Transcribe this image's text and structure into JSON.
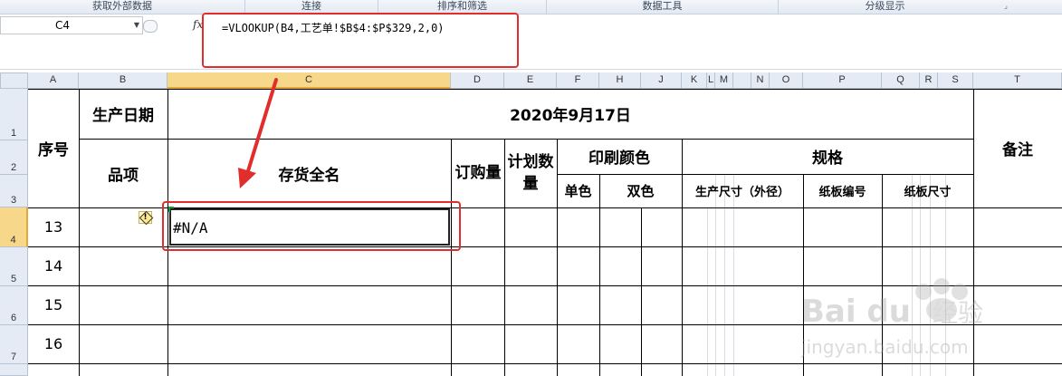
{
  "ribbon": {
    "groups": [
      "获取外部数据",
      "连接",
      "排序和筛选",
      "数据工具",
      "分级显示"
    ]
  },
  "formula_bar": {
    "name_box": "C4",
    "fx_label": "fx",
    "formula": "=VLOOKUP(B4,工艺单!$B$4:$P$329,2,0)"
  },
  "columns": [
    "A",
    "B",
    "C",
    "D",
    "E",
    "F",
    "H",
    "J",
    "K",
    "L",
    "M",
    "N",
    "O",
    "P",
    "Q",
    "R",
    "S",
    "T"
  ],
  "rows": [
    "1",
    "2",
    "3",
    "4",
    "5",
    "6",
    "7"
  ],
  "sheet": {
    "seq_header": "序号",
    "date_label": "生产日期",
    "item_label": "品项",
    "date_value": "2020年9月17日",
    "name_header": "存货全名",
    "order_qty": "订购量",
    "plan_qty": "计划数量",
    "print_color": "印刷颜色",
    "single_color": "单色",
    "double_color": "双色",
    "spec": "规格",
    "prod_size": "生产尺寸（外径）",
    "board_no": "纸板编号",
    "board_size": "纸板尺寸",
    "remark": "备注",
    "seq_values": [
      "13",
      "14",
      "15",
      "16"
    ],
    "error_value": "#N/A",
    "warning_glyph": "!"
  },
  "colors": {
    "highlight_red": "#e22d2d",
    "selected_header": "#f7d789"
  }
}
